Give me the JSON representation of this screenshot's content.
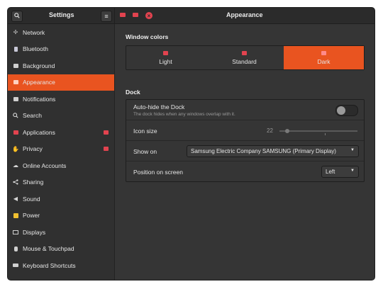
{
  "header": {
    "sidebar_title": "Settings",
    "main_title": "Appearance",
    "search_icon": "search-icon",
    "menu_icon": "hamburger-menu-icon"
  },
  "sidebar": {
    "items": [
      {
        "label": "Network",
        "icon": "network-icon"
      },
      {
        "label": "Bluetooth",
        "icon": "bluetooth-icon"
      },
      {
        "label": "Background",
        "icon": "background-icon"
      },
      {
        "label": "Appearance",
        "icon": "appearance-icon",
        "active": true
      },
      {
        "label": "Notifications",
        "icon": "notifications-icon"
      },
      {
        "label": "Search",
        "icon": "search-icon"
      },
      {
        "label": "Applications",
        "icon": "applications-icon",
        "has_arrow": true
      },
      {
        "label": "Privacy",
        "icon": "privacy-icon",
        "has_arrow": true
      },
      {
        "label": "Online Accounts",
        "icon": "online-accounts-icon"
      },
      {
        "label": "Sharing",
        "icon": "sharing-icon"
      },
      {
        "label": "Sound",
        "icon": "sound-icon"
      },
      {
        "label": "Power",
        "icon": "power-icon"
      },
      {
        "label": "Displays",
        "icon": "displays-icon"
      },
      {
        "label": "Mouse & Touchpad",
        "icon": "mouse-icon"
      },
      {
        "label": "Keyboard Shortcuts",
        "icon": "keyboard-icon"
      }
    ]
  },
  "window_colors": {
    "title": "Window colors",
    "options": [
      {
        "label": "Light"
      },
      {
        "label": "Standard"
      },
      {
        "label": "Dark"
      }
    ],
    "selected": "Dark"
  },
  "dock": {
    "title": "Dock",
    "autohide": {
      "label": "Auto-hide the Dock",
      "sublabel": "The dock hides when any windows overlap with it.",
      "enabled": false
    },
    "icon_size": {
      "label": "Icon size",
      "value": "22"
    },
    "show_on": {
      "label": "Show on",
      "value": "Samsung Electric Company SAMSUNG (Primary Display)"
    },
    "position": {
      "label": "Position on screen",
      "value": "Left"
    }
  },
  "colors": {
    "accent": "#e95420",
    "sidebar_bg": "#303030",
    "window_bg": "#353535",
    "header_bg": "#2b2b2b"
  }
}
